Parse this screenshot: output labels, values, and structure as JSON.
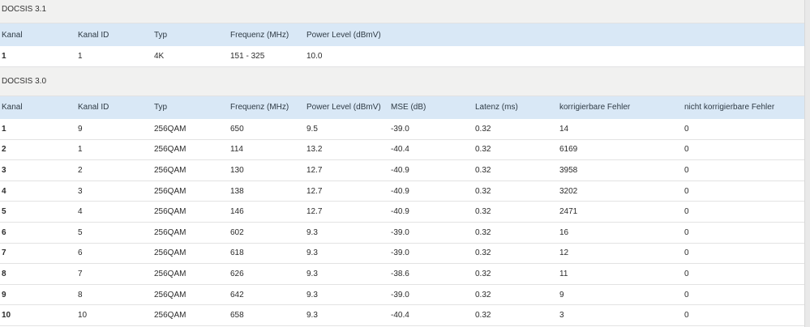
{
  "docsis31": {
    "title": "DOCSIS 3.1",
    "headers": [
      "Kanal",
      "Kanal ID",
      "Typ",
      "Frequenz (MHz)",
      "Power Level (dBmV)"
    ],
    "rows": [
      [
        "1",
        "1",
        "4K",
        "151 - 325",
        "10.0"
      ]
    ]
  },
  "docsis30": {
    "title": "DOCSIS 3.0",
    "headers": [
      "Kanal",
      "Kanal ID",
      "Typ",
      "Frequenz (MHz)",
      "Power Level (dBmV)",
      "MSE (dB)",
      "Latenz (ms)",
      "korrigierbare Fehler",
      "nicht korrigierbare Fehler"
    ],
    "rows": [
      [
        "1",
        "9",
        "256QAM",
        "650",
        "9.5",
        "-39.0",
        "0.32",
        "14",
        "0"
      ],
      [
        "2",
        "1",
        "256QAM",
        "114",
        "13.2",
        "-40.4",
        "0.32",
        "6169",
        "0"
      ],
      [
        "3",
        "2",
        "256QAM",
        "130",
        "12.7",
        "-40.9",
        "0.32",
        "3958",
        "0"
      ],
      [
        "4",
        "3",
        "256QAM",
        "138",
        "12.7",
        "-40.9",
        "0.32",
        "3202",
        "0"
      ],
      [
        "5",
        "4",
        "256QAM",
        "146",
        "12.7",
        "-40.9",
        "0.32",
        "2471",
        "0"
      ],
      [
        "6",
        "5",
        "256QAM",
        "602",
        "9.3",
        "-39.0",
        "0.32",
        "16",
        "0"
      ],
      [
        "7",
        "6",
        "256QAM",
        "618",
        "9.3",
        "-39.0",
        "0.32",
        "12",
        "0"
      ],
      [
        "8",
        "7",
        "256QAM",
        "626",
        "9.3",
        "-38.6",
        "0.32",
        "11",
        "0"
      ],
      [
        "9",
        "8",
        "256QAM",
        "642",
        "9.3",
        "-39.0",
        "0.32",
        "9",
        "0"
      ],
      [
        "10",
        "10",
        "256QAM",
        "658",
        "9.3",
        "-40.4",
        "0.32",
        "3",
        "0"
      ]
    ]
  }
}
